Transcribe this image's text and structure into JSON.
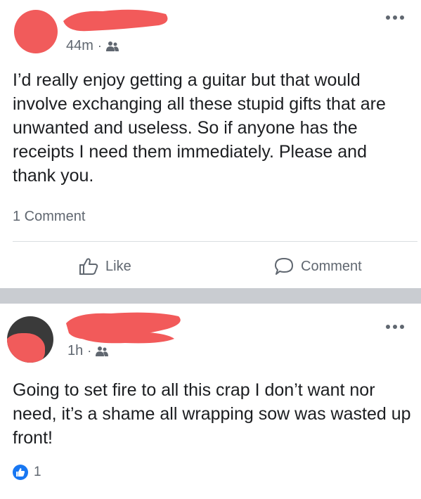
{
  "post1": {
    "time": "44m",
    "audience_icon": "friends-icon",
    "text": "I’d really enjoy getting a guitar but that would involve exchanging all these stupid gifts that are unwanted and useless. So if anyone has the receipts I need them immediately. Please and thank you.",
    "comments_count": "1 Comment",
    "like_label": "Like",
    "comment_label": "Comment"
  },
  "post2": {
    "time": "1h",
    "audience_icon": "friends-icon",
    "text": "Going to set fire to all this crap I don’t want nor need, it’s a shame all wrapping sow was wasted up front!",
    "reaction_count": "1"
  },
  "colors": {
    "redaction": "#f25a5a",
    "accent": "#1877f2",
    "secondary_text": "#606770",
    "separator": "#c9ccd1"
  }
}
